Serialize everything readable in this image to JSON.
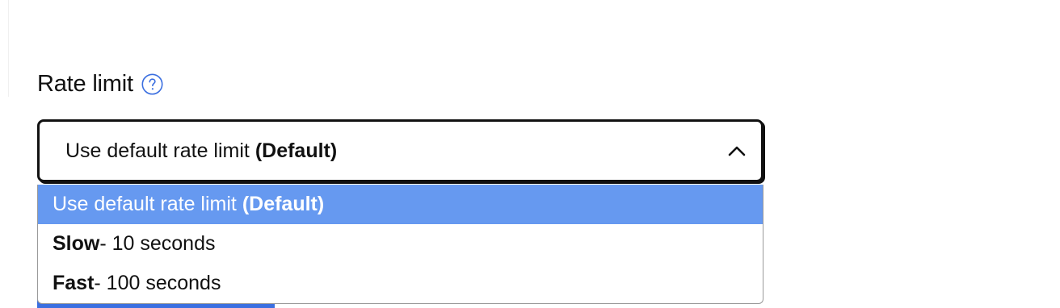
{
  "field": {
    "label": "Rate limit",
    "help_icon": "question-circle-icon"
  },
  "select": {
    "value_text": "Use default rate limit",
    "value_suffix": "(Default)",
    "chevron_icon": "chevron-up-icon",
    "expanded": true
  },
  "options": [
    {
      "bold": "",
      "text": "Use default rate limit ",
      "bold_suffix": "(Default)",
      "selected": true
    },
    {
      "bold": "Slow",
      "text": " - 10 seconds",
      "bold_suffix": "",
      "selected": false
    },
    {
      "bold": "Fast",
      "text": " - 100 seconds",
      "bold_suffix": "",
      "selected": false
    }
  ],
  "colors": {
    "selected_option_bg": "#6699f0",
    "help_icon": "#3b6fe0",
    "border": "#111111",
    "button_peek": "#3b6fe0"
  }
}
